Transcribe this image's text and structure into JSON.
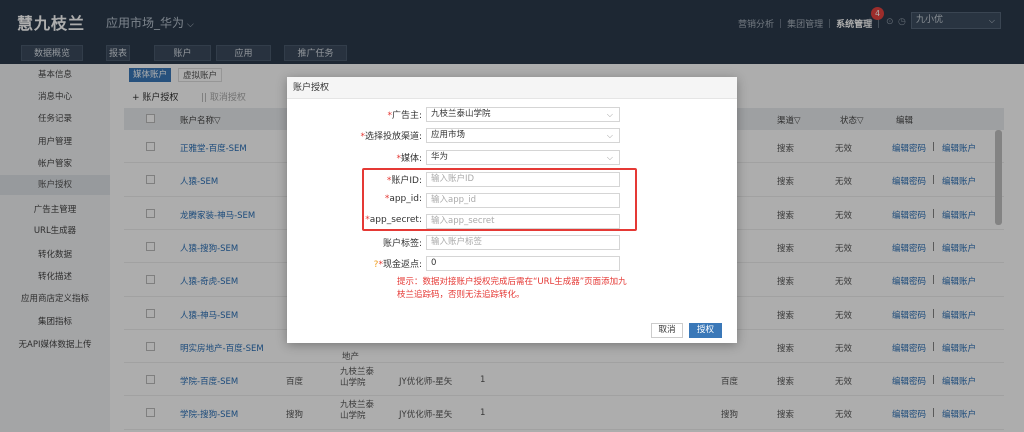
{
  "header": {
    "logo": "慧九枝兰",
    "app_name": "应用市场_华为",
    "nav": [
      "营销分析",
      "集团管理",
      "系统管理"
    ],
    "badge_count": "4",
    "user": "九小优"
  },
  "top_buttons": [
    "数据概览",
    "报表",
    "账户",
    "应用",
    "推广任务"
  ],
  "sidebar": {
    "items": [
      "基本信息",
      "消息中心",
      "任务记录",
      "用户管理",
      "帐户管家",
      "账户授权",
      "广告主管理",
      "URL生成器",
      "转化数据",
      "转化描述",
      "应用商店定义指标",
      "集团指标",
      "无API媒体数据上传"
    ]
  },
  "subtabs": [
    "媒体账户",
    "虚拟账户"
  ],
  "toolbar": {
    "add": "+ 账户授权",
    "cancel": "|| 取消授权"
  },
  "table": {
    "headers": [
      "账户名称▽",
      "渠道▽",
      "状态▽",
      "编辑"
    ],
    "rows": [
      {
        "name": "正雅堂-百度-SEM",
        "channel": "搜索",
        "status": "无效",
        "edit": "编辑密码",
        "edit2": "编辑账户"
      },
      {
        "name": "人猿-SEM",
        "channel": "搜索",
        "status": "无效",
        "edit": "编辑密码",
        "edit2": "编辑账户"
      },
      {
        "name": "龙腾家装-神马-SEM",
        "channel": "搜索",
        "status": "无效",
        "edit": "编辑密码",
        "edit2": "编辑账户"
      },
      {
        "name": "人猿-搜狗-SEM",
        "channel": "搜索",
        "status": "无效",
        "edit": "编辑密码",
        "edit2": "编辑账户"
      },
      {
        "name": "人猿-奇虎-SEM",
        "channel": "搜索",
        "status": "无效",
        "edit": "编辑密码",
        "edit2": "编辑账户"
      },
      {
        "name": "人猿-神马-SEM",
        "channel": "搜索",
        "status": "无效",
        "edit": "编辑密码",
        "edit2": "编辑账户"
      },
      {
        "name": "明实房地产-百度-SEM",
        "extra": "地产",
        "channel": "搜索",
        "status": "无效",
        "edit": "编辑密码",
        "edit2": "编辑账户"
      },
      {
        "name": "学院-百度-SEM",
        "media": "百度",
        "advertiser": "九枝兰泰山学院",
        "owner": "JY优化师-星矢",
        "num": "1",
        "media2": "百度",
        "channel": "搜索",
        "status": "无效",
        "edit": "编辑密码",
        "edit2": "编辑账户"
      },
      {
        "name": "学院-搜狗-SEM",
        "media": "搜狗",
        "advertiser": "九枝兰泰山学院",
        "owner": "JY优化师-星矢",
        "num": "1",
        "media2": "搜狗",
        "channel": "搜索",
        "status": "无效",
        "edit": "编辑密码",
        "edit2": "编辑账户"
      }
    ]
  },
  "modal": {
    "title": "账户授权",
    "fields": [
      {
        "label": "广告主:",
        "value": "九枝兰泰山学院"
      },
      {
        "label": "选择投放渠道:",
        "value": "应用市场"
      },
      {
        "label": "媒体:",
        "value": "华为"
      },
      {
        "label": "账户ID:",
        "placeholder": "输入账户ID"
      },
      {
        "label": "app_id:",
        "placeholder": "输入app_id"
      },
      {
        "label": "app_secret:",
        "placeholder": "输入app_secret"
      },
      {
        "label": "账户标签:",
        "placeholder": "输入账户标签"
      },
      {
        "label": "现金返点:",
        "value": "0"
      }
    ],
    "tip": "提示：数据对接账户授权完成后需在“URL生成器”页面添加九枝兰追踪码，否则无法追踪转化。",
    "cancel": "取消",
    "confirm": "授权"
  }
}
